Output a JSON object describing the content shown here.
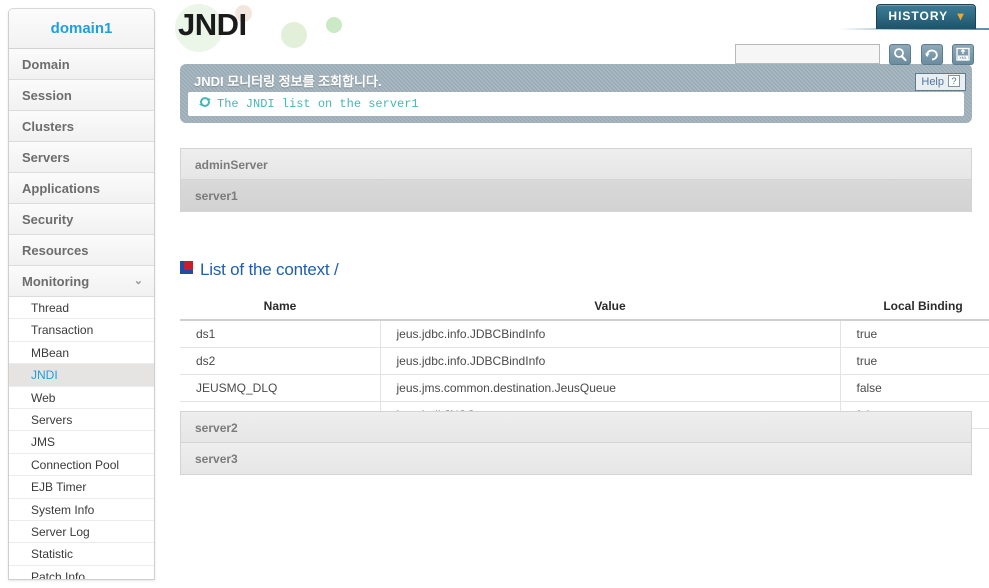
{
  "sidebar": {
    "domain_title": "domain1",
    "main_items": [
      {
        "label": "Domain",
        "expanded": false
      },
      {
        "label": "Session",
        "expanded": false
      },
      {
        "label": "Clusters",
        "expanded": false
      },
      {
        "label": "Servers",
        "expanded": false
      },
      {
        "label": "Applications",
        "expanded": false
      },
      {
        "label": "Security",
        "expanded": false
      },
      {
        "label": "Resources",
        "expanded": false
      },
      {
        "label": "Monitoring",
        "expanded": true
      }
    ],
    "sub_items": [
      {
        "label": "Thread",
        "active": false
      },
      {
        "label": "Transaction",
        "active": false
      },
      {
        "label": "MBean",
        "active": false
      },
      {
        "label": "JNDI",
        "active": true
      },
      {
        "label": "Web",
        "active": false
      },
      {
        "label": "Servers",
        "active": false
      },
      {
        "label": "JMS",
        "active": false
      },
      {
        "label": "Connection Pool",
        "active": false
      },
      {
        "label": "EJB Timer",
        "active": false
      },
      {
        "label": "System Info",
        "active": false
      },
      {
        "label": "Server Log",
        "active": false
      },
      {
        "label": "Statistic",
        "active": false
      },
      {
        "label": "Patch Info",
        "active": false
      }
    ],
    "chevron_glyph": "⌄",
    "accent_color": "#1e9fe0",
    "active_bg": "#e6e4e2"
  },
  "header": {
    "logo_text": "JNDI",
    "history_label": "HISTORY",
    "history_chevron": "❯",
    "history_accent": "#f5a623",
    "history_bg": "#2e6b84",
    "search_value": "",
    "search_placeholder": "",
    "tools": [
      {
        "name": "search-icon",
        "title": "Search"
      },
      {
        "name": "refresh-icon",
        "title": "Refresh"
      },
      {
        "name": "xml-export-icon",
        "title": "XML"
      }
    ]
  },
  "banner": {
    "title": "JNDI 모니터링 정보를 조회합니다.",
    "sub_text": "The JNDI list on the server1",
    "sub_icon": "sync-icon",
    "sub_color": "#44b8b8",
    "help_label": "Help",
    "help_glyph": "?",
    "bg_color": "#9aabb5"
  },
  "servers": {
    "above": [
      {
        "label": "adminServer",
        "selected": false
      },
      {
        "label": "server1",
        "selected": true
      }
    ],
    "below": [
      {
        "label": "server2",
        "selected": false
      },
      {
        "label": "server3",
        "selected": false
      }
    ]
  },
  "section": {
    "icon": "context-square-icon",
    "title": "List of the context /",
    "title_color": "#1d5fb0"
  },
  "table": {
    "columns": [
      "Name",
      "Value",
      "Local Binding"
    ],
    "rows": [
      {
        "name": "ds1",
        "value": "jeus.jdbc.info.JDBCBindInfo",
        "local_binding": "true"
      },
      {
        "name": "ds2",
        "value": "jeus.jdbc.info.JDBCBindInfo",
        "local_binding": "true"
      },
      {
        "name": "JEUSMQ_DLQ",
        "value": "jeus.jms.common.destination.JeusQueue",
        "local_binding": "false"
      },
      {
        "name": "mgmt",
        "value": "jeus.jndi.JNSContext",
        "local_binding": "false"
      }
    ]
  }
}
